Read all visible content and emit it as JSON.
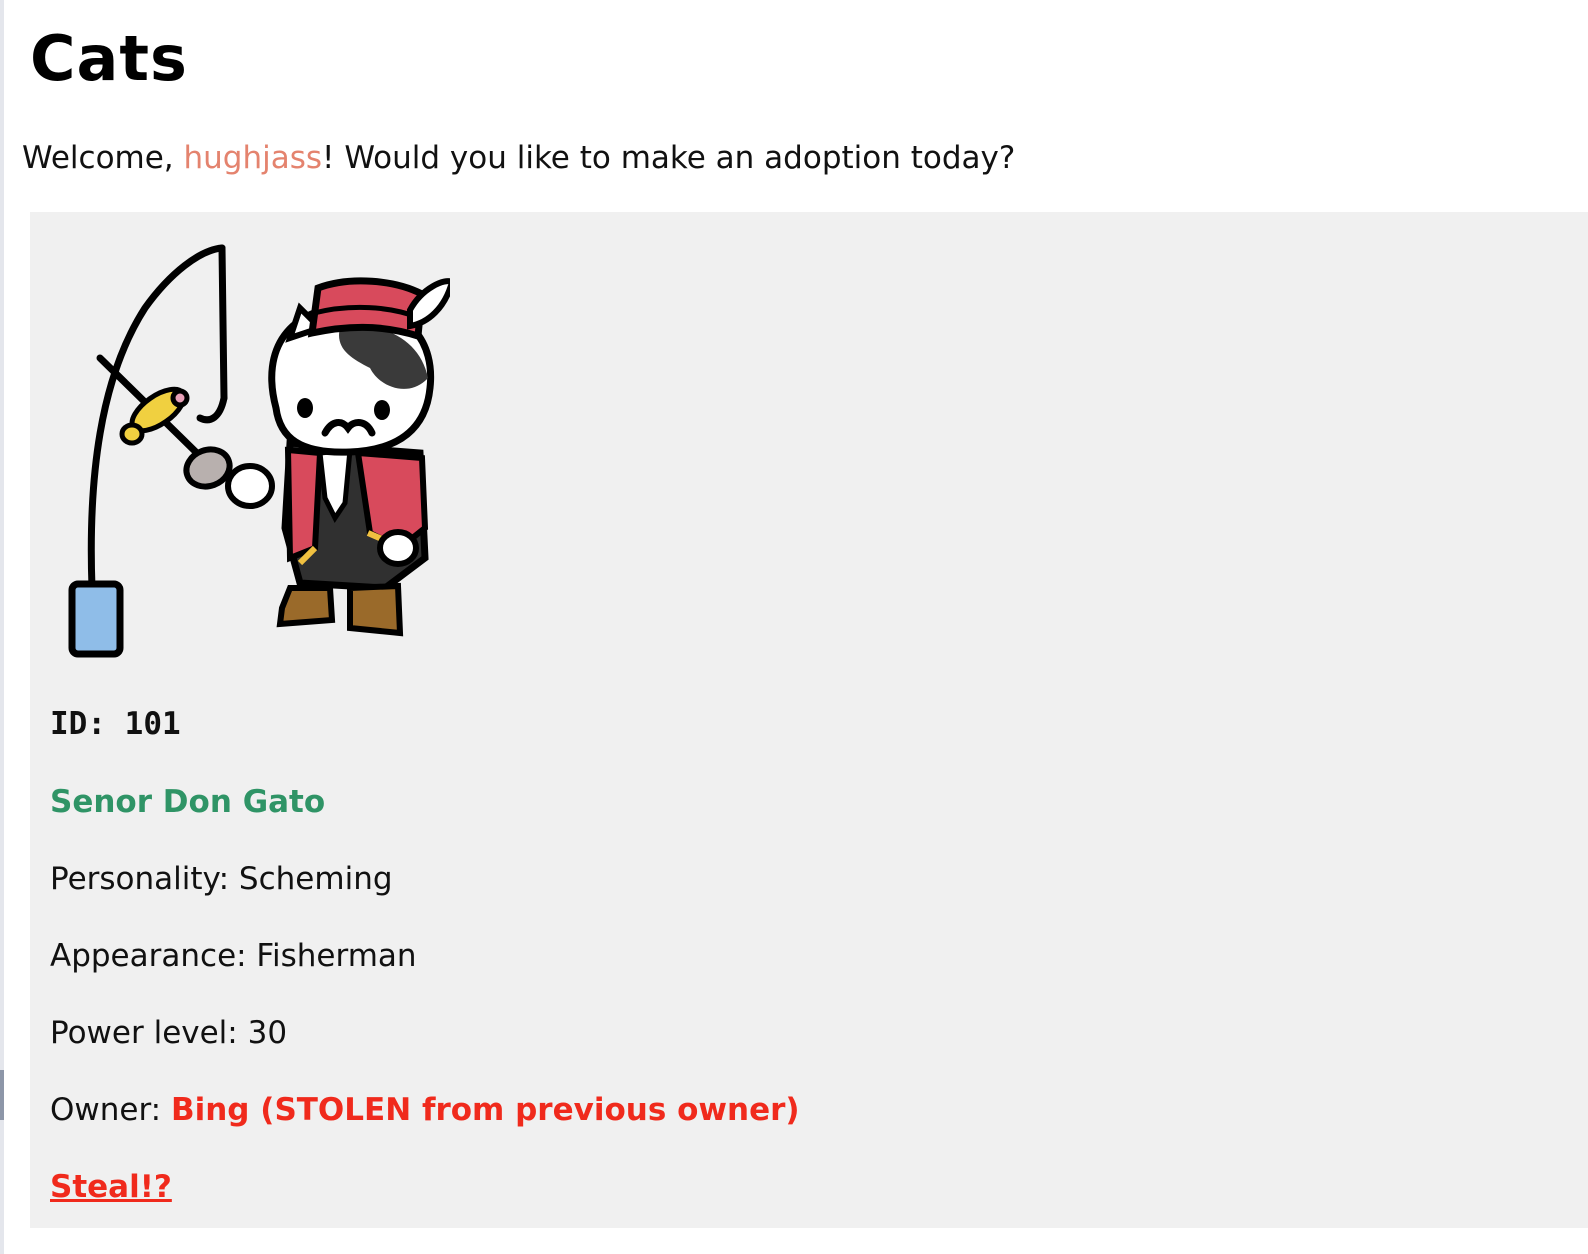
{
  "page": {
    "title": "Cats"
  },
  "welcome": {
    "prefix": "Welcome, ",
    "username": "hughjass",
    "suffix": "! Would you like to make an adoption today?"
  },
  "cat": {
    "image_alt": "Senor Don Gato fisherman cat",
    "id_label": "ID: 101",
    "name": "Senor Don Gato",
    "personality": "Personality: Scheming",
    "appearance": "Appearance: Fisherman",
    "power_level": "Power level: 30",
    "owner_label": "Owner: ",
    "owner_value": "Bing (STOLEN from previous owner)",
    "steal_label": "Steal!?"
  },
  "colors": {
    "username": "#e4836e",
    "cat_name": "#2f9466",
    "owner_value": "#f02a1c",
    "card_background": "#f0f0f0"
  }
}
